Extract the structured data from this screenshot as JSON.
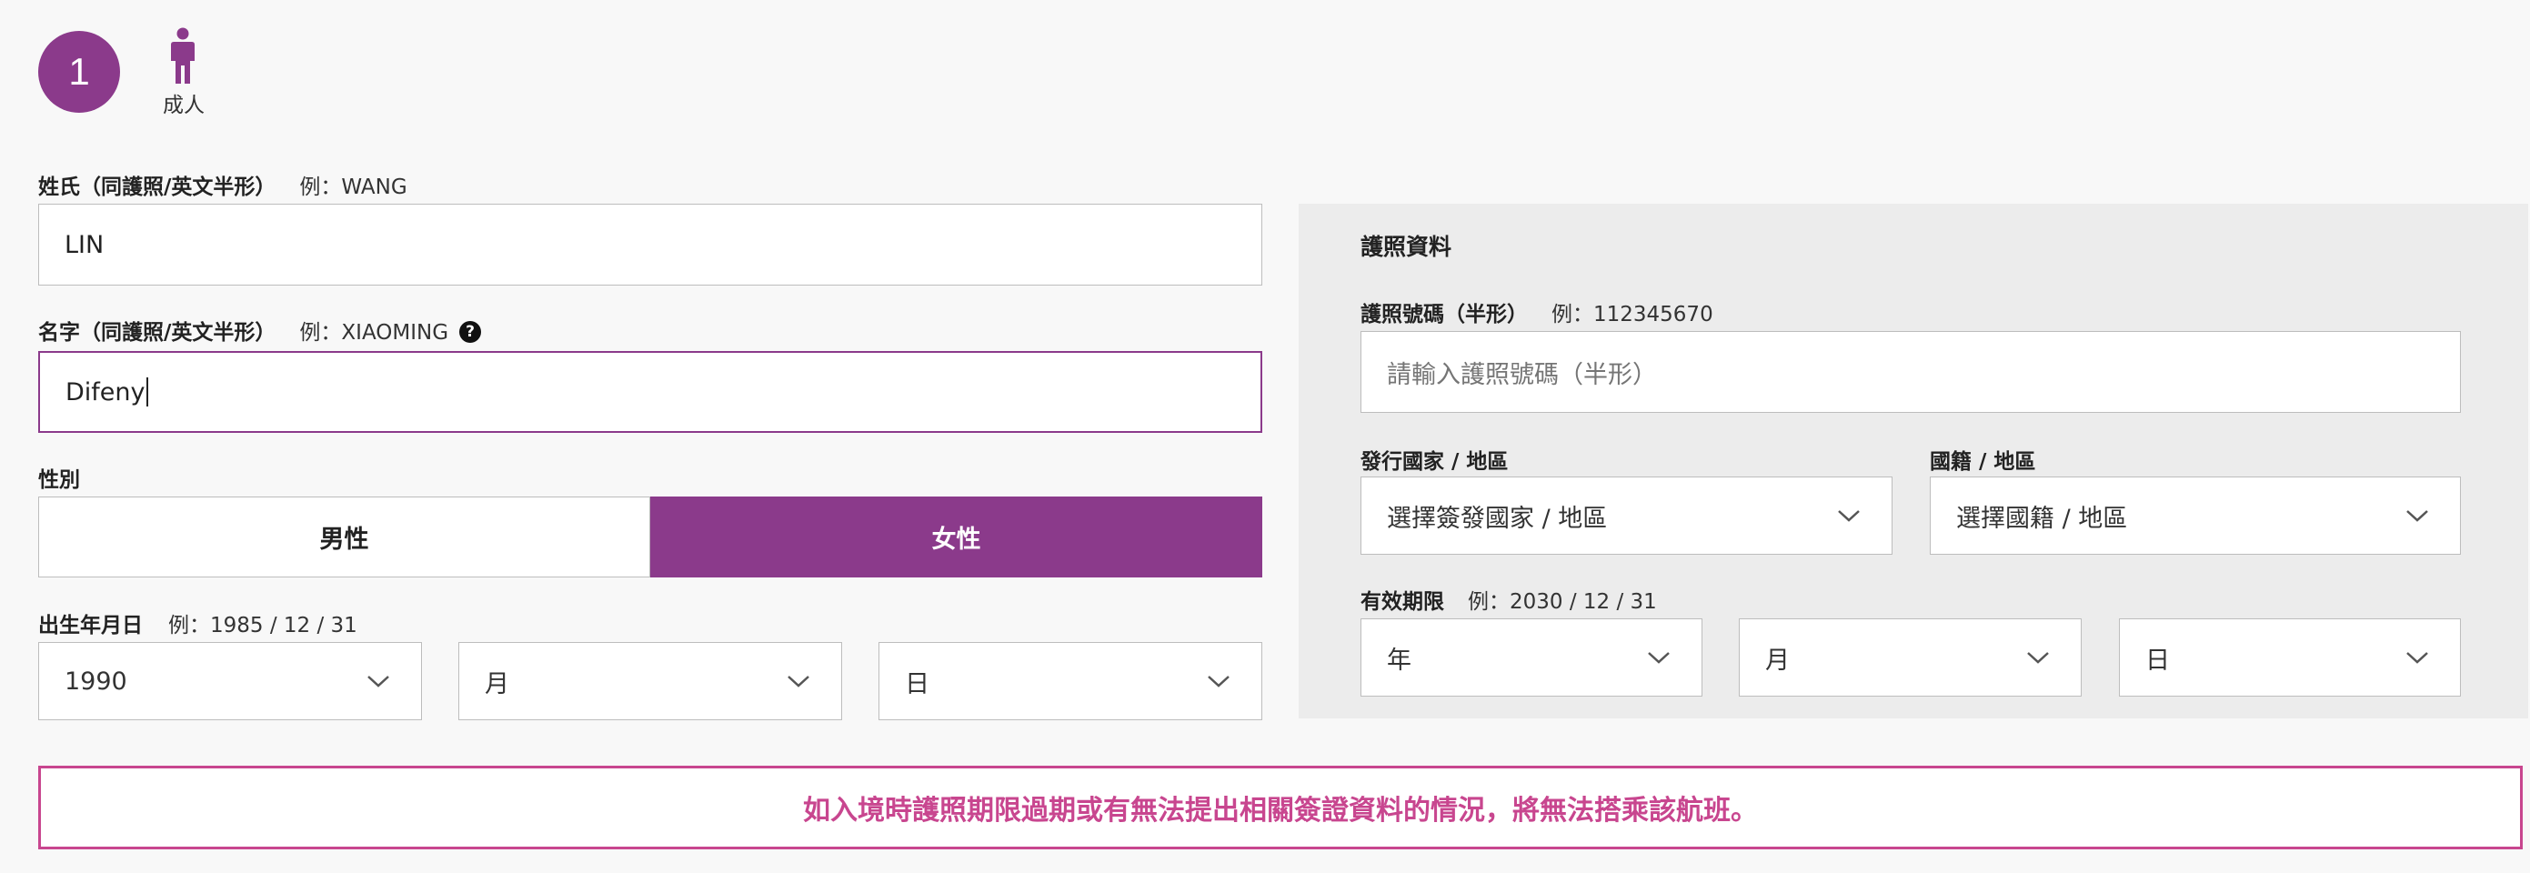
{
  "passenger": {
    "number": "1",
    "type_icon": "adult-person-icon",
    "type_label": "成人"
  },
  "surname": {
    "label": "姓氏（同護照/英文半形）",
    "example": "例：WANG",
    "value": "LIN"
  },
  "given_name": {
    "label": "名字（同護照/英文半形）",
    "example": "例：XIAOMING",
    "help_icon": "question-circle-icon",
    "value": "Difeny"
  },
  "gender": {
    "label": "性別",
    "options": [
      "男性",
      "女性"
    ],
    "selected": "女性"
  },
  "birth_date": {
    "label": "出生年月日",
    "example": "例：1985 / 12 / 31",
    "year": "1990",
    "month": "月",
    "day": "日"
  },
  "passport": {
    "section_title": "護照資料",
    "number_label": "護照號碼（半形）",
    "number_example": "例：112345670",
    "number_placeholder": "請輸入護照號碼（半形）",
    "issuing_label": "發行國家 / 地區",
    "issuing_value": "選擇簽發國家 / 地區",
    "nationality_label": "國籍 / 地區",
    "nationality_value": "選擇國籍 / 地區",
    "expiry_label": "有效期限",
    "expiry_example": "例：2030 / 12 / 31",
    "expiry_year": "年",
    "expiry_month": "月",
    "expiry_day": "日"
  },
  "notice": {
    "text": "如入境時護照期限過期或有無法提出相關簽證資料的情況，將無法搭乘該航班。"
  },
  "colors": {
    "accent": "#8b3a8b",
    "notice": "#c8468f",
    "panel_bg": "#ececec"
  }
}
